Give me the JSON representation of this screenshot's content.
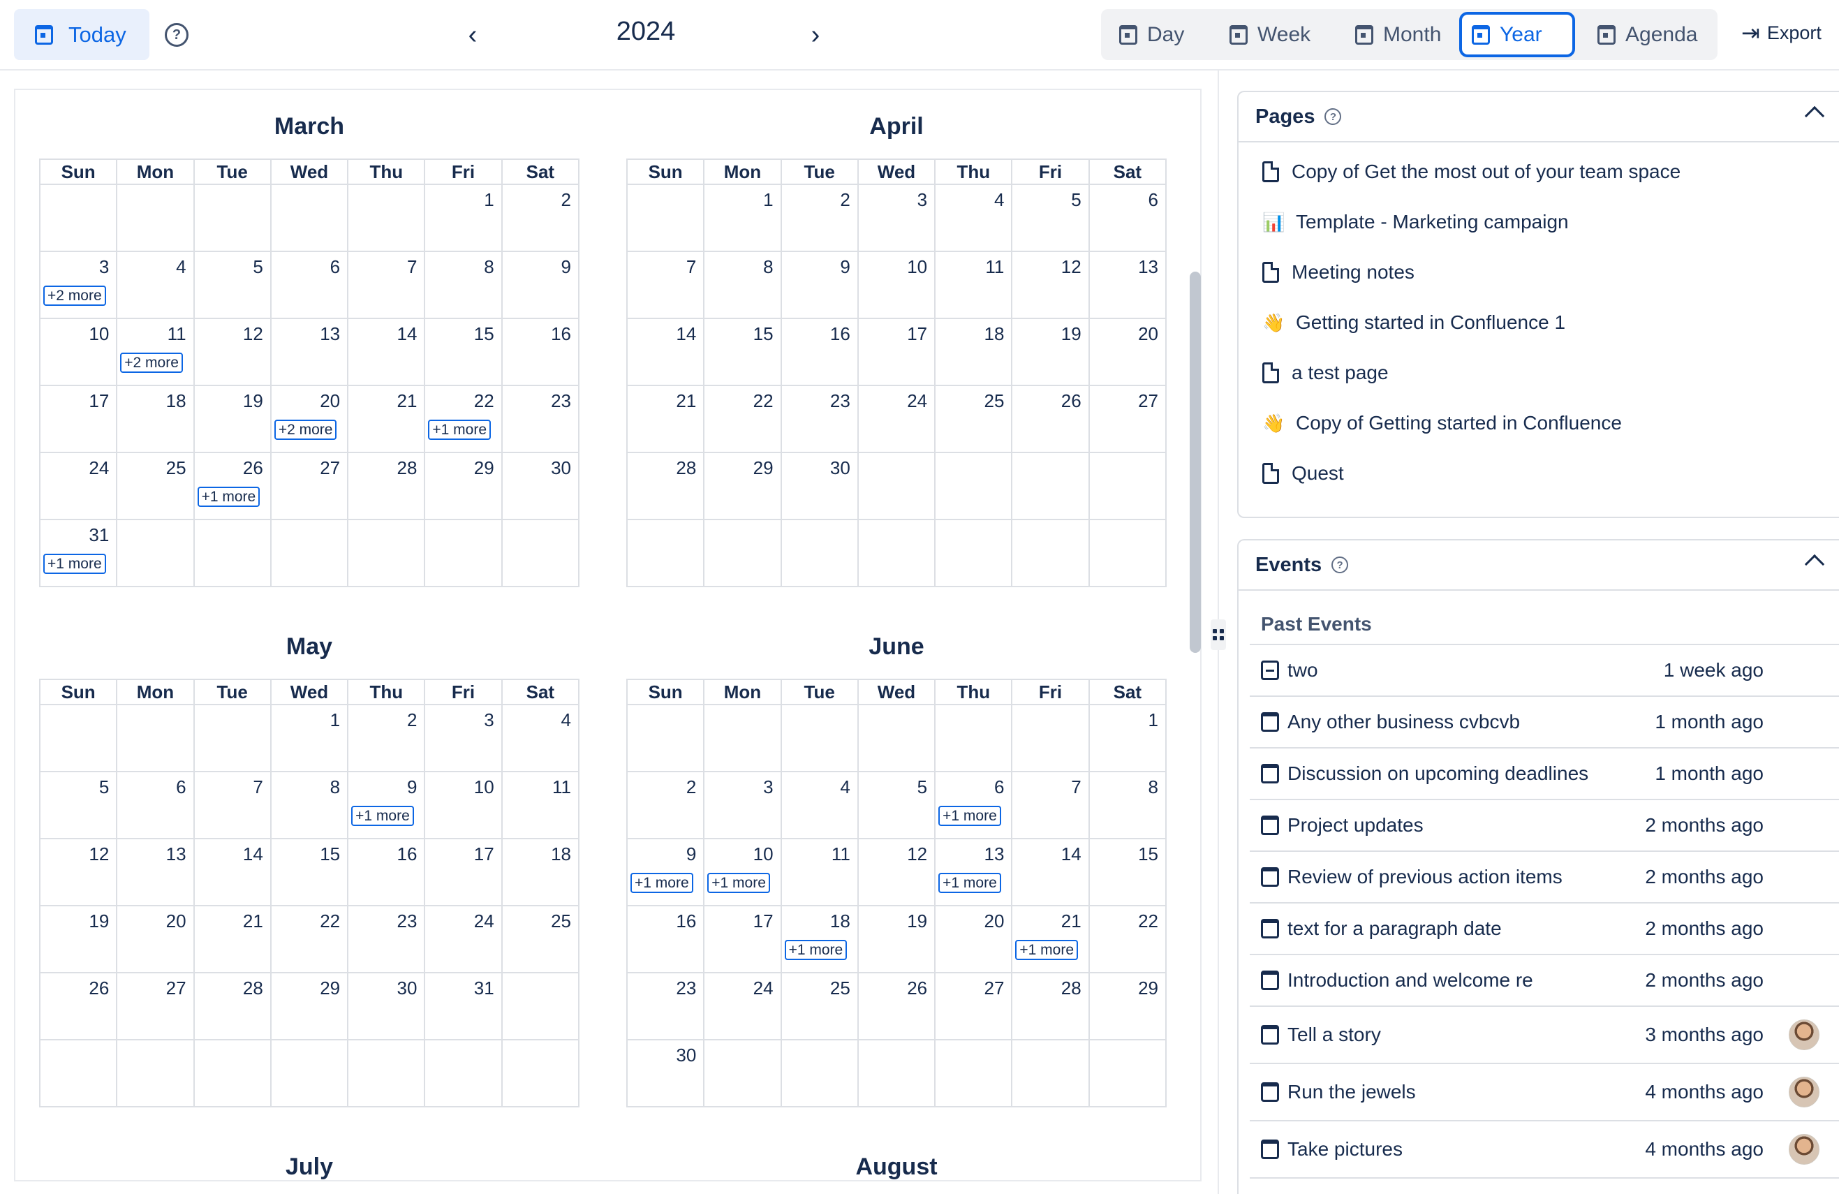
{
  "toolbar": {
    "today_label": "Today",
    "year": "2024",
    "views": [
      "Day",
      "Week",
      "Month",
      "Year",
      "Agenda"
    ],
    "active_view": "Year",
    "export_label": "Export"
  },
  "weekdays": [
    "Sun",
    "Mon",
    "Tue",
    "Wed",
    "Thu",
    "Fri",
    "Sat"
  ],
  "months": [
    {
      "name": "March",
      "weeks": [
        [
          "",
          "",
          "",
          "",
          "",
          "1",
          "2"
        ],
        [
          "3",
          "4",
          "5",
          "6",
          "7",
          "8",
          "9"
        ],
        [
          "10",
          "11",
          "12",
          "13",
          "14",
          "15",
          "16"
        ],
        [
          "17",
          "18",
          "19",
          "20",
          "21",
          "22",
          "23"
        ],
        [
          "24",
          "25",
          "26",
          "27",
          "28",
          "29",
          "30"
        ],
        [
          "31",
          "",
          "",
          "",
          "",
          "",
          ""
        ]
      ]
    },
    {
      "name": "April",
      "weeks": [
        [
          "",
          "1",
          "2",
          "3",
          "4",
          "5",
          "6"
        ],
        [
          "7",
          "8",
          "9",
          "10",
          "11",
          "12",
          "13"
        ],
        [
          "14",
          "15",
          "16",
          "17",
          "18",
          "19",
          "20"
        ],
        [
          "21",
          "22",
          "23",
          "24",
          "25",
          "26",
          "27"
        ],
        [
          "28",
          "29",
          "30",
          "",
          "",
          "",
          ""
        ],
        [
          "",
          "",
          "",
          "",
          "",
          "",
          ""
        ]
      ]
    },
    {
      "name": "May",
      "weeks": [
        [
          "",
          "",
          "",
          "1",
          "2",
          "3",
          "4"
        ],
        [
          "5",
          "6",
          "7",
          "8",
          "9",
          "10",
          "11"
        ],
        [
          "12",
          "13",
          "14",
          "15",
          "16",
          "17",
          "18"
        ],
        [
          "19",
          "20",
          "21",
          "22",
          "23",
          "24",
          "25"
        ],
        [
          "26",
          "27",
          "28",
          "29",
          "30",
          "31",
          ""
        ],
        [
          "",
          "",
          "",
          "",
          "",
          "",
          ""
        ]
      ]
    },
    {
      "name": "June",
      "weeks": [
        [
          "",
          "",
          "",
          "",
          "",
          "",
          "1"
        ],
        [
          "2",
          "3",
          "4",
          "5",
          "6",
          "7",
          "8"
        ],
        [
          "9",
          "10",
          "11",
          "12",
          "13",
          "14",
          "15"
        ],
        [
          "16",
          "17",
          "18",
          "19",
          "20",
          "21",
          "22"
        ],
        [
          "23",
          "24",
          "25",
          "26",
          "27",
          "28",
          "29"
        ],
        [
          "30",
          "",
          "",
          "",
          "",
          "",
          ""
        ]
      ]
    },
    {
      "name": "July",
      "weeks": []
    },
    {
      "name": "August",
      "weeks": []
    }
  ],
  "more_badges": {
    "0": {
      "1-0": "+2 more",
      "2-1": "+2 more",
      "3-3": "+2 more",
      "3-5": "+1 more",
      "4-2": "+1 more",
      "5-0": "+1 more"
    },
    "2": {
      "1-4": "+1 more"
    },
    "3": {
      "1-4": "+1 more",
      "2-0": "+1 more",
      "2-1": "+1 more",
      "2-4": "+1 more",
      "3-2": "+1 more",
      "3-5": "+1 more"
    }
  },
  "pages": {
    "title": "Pages",
    "items": [
      {
        "icon": "doc",
        "label": "Copy of Get the most out of your team space"
      },
      {
        "icon": "chart-emoji",
        "label": "Template - Marketing campaign"
      },
      {
        "icon": "doc",
        "label": "Meeting notes"
      },
      {
        "icon": "wave-emoji",
        "label": "Getting started in Confluence 1"
      },
      {
        "icon": "doc",
        "label": "a test page"
      },
      {
        "icon": "wave-emoji",
        "label": "Copy of Getting started in Confluence"
      },
      {
        "icon": "doc",
        "label": "Quest"
      }
    ]
  },
  "events": {
    "title": "Events",
    "section": "Past Events",
    "items": [
      {
        "icon": "task",
        "label": "two",
        "time": "1 week ago",
        "avatar": false
      },
      {
        "icon": "calendar",
        "label": "Any other business cvbcvb",
        "time": "1 month ago",
        "avatar": false
      },
      {
        "icon": "calendar",
        "label": "Discussion on upcoming deadlines",
        "time": "1 month ago",
        "avatar": false
      },
      {
        "icon": "calendar",
        "label": "Project updates",
        "time": "2 months ago",
        "avatar": false
      },
      {
        "icon": "calendar",
        "label": "Review of previous action items",
        "time": "2 months ago",
        "avatar": false
      },
      {
        "icon": "calendar",
        "label": "text for a paragraph date",
        "time": "2 months ago",
        "avatar": false
      },
      {
        "icon": "calendar",
        "label": "Introduction and welcome re",
        "time": "2 months ago",
        "avatar": false
      },
      {
        "icon": "calendar",
        "label": "Tell a story",
        "time": "3 months ago",
        "avatar": true
      },
      {
        "icon": "calendar",
        "label": "Run the jewels",
        "time": "4 months ago",
        "avatar": true
      },
      {
        "icon": "calendar",
        "label": "Take pictures",
        "time": "4 months ago",
        "avatar": true
      }
    ]
  },
  "colors": {
    "accent": "#0c66e4",
    "border": "#dcdfe4",
    "text": "#172b4d"
  }
}
